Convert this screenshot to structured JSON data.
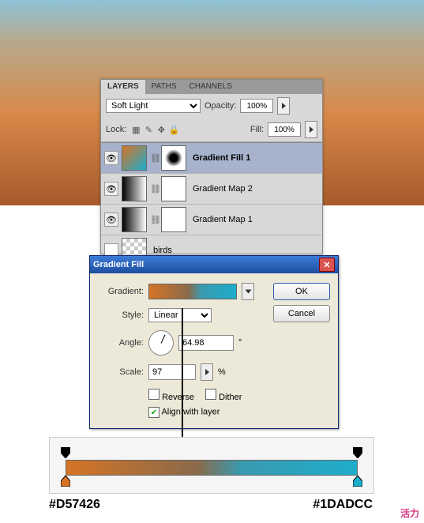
{
  "layers_panel": {
    "tabs": [
      "LAYERS",
      "PATHS",
      "CHANNELS"
    ],
    "blend_mode": "Soft Light",
    "opacity_label": "Opacity:",
    "opacity_value": "100%",
    "lock_label": "Lock:",
    "fill_label": "Fill:",
    "fill_value": "100%",
    "layers": [
      {
        "name": "Gradient Fill 1"
      },
      {
        "name": "Gradient Map 2"
      },
      {
        "name": "Gradient Map 1"
      },
      {
        "name": "birds"
      }
    ]
  },
  "dialog": {
    "title": "Gradient Fill",
    "ok": "OK",
    "cancel": "Cancel",
    "gradient_label": "Gradient:",
    "style_label": "Style:",
    "style_value": "Linear",
    "angle_label": "Angle:",
    "angle_value": "64.98",
    "angle_unit": "°",
    "scale_label": "Scale:",
    "scale_value": "97",
    "scale_unit": "%",
    "reverse": "Reverse",
    "dither": "Dither",
    "align": "Align with layer"
  },
  "hex": {
    "left": "#D57426",
    "right": "#1DADCC"
  },
  "watermark": "活力"
}
